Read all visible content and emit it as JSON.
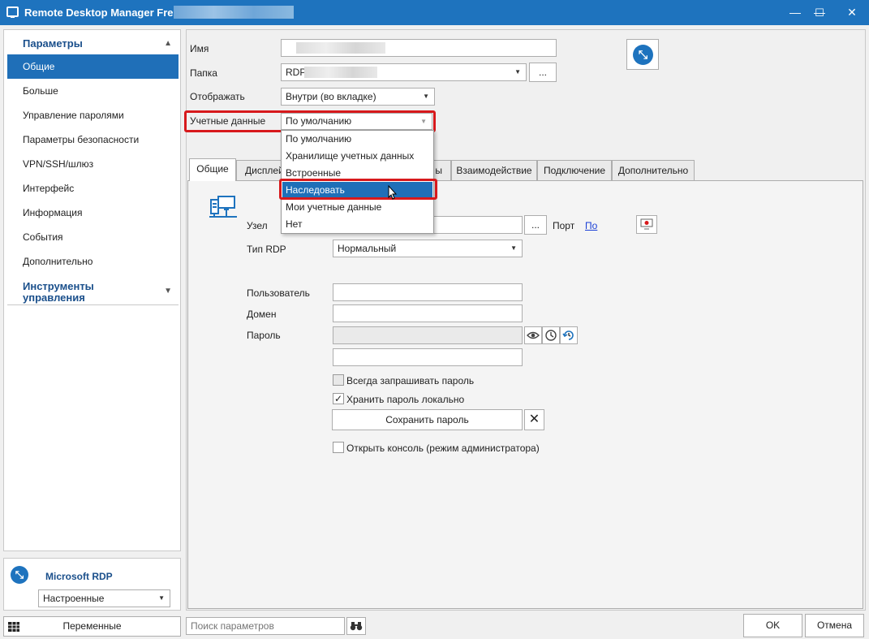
{
  "window": {
    "title": "Remote Desktop Manager Free -",
    "controls": {
      "minimize": "—",
      "maximize": "☐",
      "close": "✕"
    }
  },
  "sidebar": {
    "group1_title": "Параметры",
    "items": [
      {
        "label": "Общие",
        "active": true
      },
      {
        "label": "Больше"
      },
      {
        "label": "Управление паролями"
      },
      {
        "label": "Параметры безопасности"
      },
      {
        "label": "VPN/SSH/шлюз"
      },
      {
        "label": "Интерфейс"
      },
      {
        "label": "Информация"
      },
      {
        "label": "События"
      },
      {
        "label": "Дополнительно"
      }
    ],
    "group2_title_line1": "Инструменты",
    "group2_title_line2": "управления"
  },
  "rdp_panel": {
    "title": "Microsoft RDP",
    "mode_value": "Настроенные"
  },
  "form": {
    "name_label": "Имя",
    "folder_label": "Папка",
    "folder_value": "RDP\\",
    "folder_browse": "...",
    "display_label": "Отображать",
    "display_value": "Внутри (во вкладке)",
    "credentials_label": "Учетные данные",
    "credentials_value": "По умолчанию"
  },
  "credentials_dropdown": {
    "options": [
      "По умолчанию",
      "Хранилище учетных данных",
      "Встроенные",
      "Наследовать",
      "Мои учетные данные",
      "Нет"
    ],
    "selected_index": 3
  },
  "tabs": {
    "general": "Общие",
    "display": "Дисплей",
    "resources_suffix": "ы",
    "interaction": "Взаимодействие",
    "connection": "Подключение",
    "advanced": "Дополнительно"
  },
  "general_tab": {
    "host_label": "Узел",
    "host_browse": "...",
    "port_label": "Порт",
    "port_link": "По",
    "rdp_type_label": "Тип RDP",
    "rdp_type_value": "Нормальный",
    "user_label": "Пользователь",
    "domain_label": "Домен",
    "password_label": "Пароль",
    "always_ask_password": "Всегда запрашивать пароль",
    "always_ask_checked": false,
    "store_locally": "Хранить пароль локально",
    "store_locally_checked": true,
    "save_password_button": "Сохранить пароль",
    "clear_button": "✕",
    "open_console": "Открыть консоль (режим администратора)",
    "open_console_checked": false
  },
  "bottom": {
    "variables_button": "Переменные",
    "search_placeholder": "Поиск параметров",
    "ok_button": "OK",
    "cancel_button": "Отмена"
  },
  "colors": {
    "titlebar": "#1e73be",
    "selection": "#1f6fb8",
    "highlight": "#d7191c",
    "link": "#1a3fd6"
  }
}
